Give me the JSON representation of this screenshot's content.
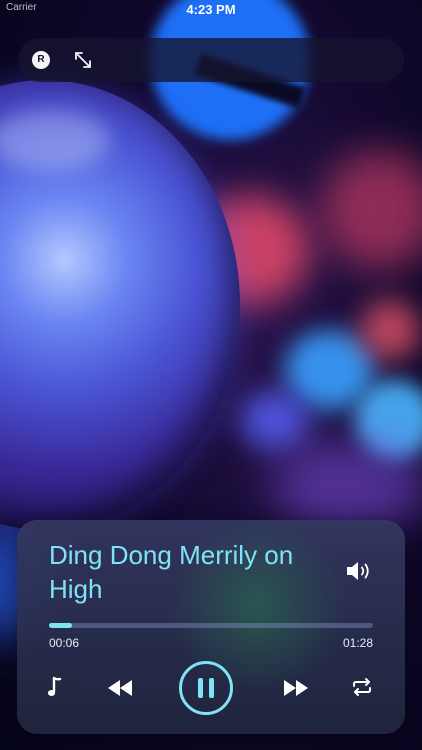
{
  "status_bar": {
    "carrier": "Carrier",
    "time": "4:23 PM"
  },
  "top_bar": {
    "badge_label": "R",
    "expand_icon": "expand-icon"
  },
  "player": {
    "title": "Ding Dong Merrily on High",
    "elapsed": "00:06",
    "total": "01:28",
    "progress": 0.07,
    "state": "playing",
    "accent_color": "#7fe3f6",
    "icons": [
      "music-note-icon",
      "rewind-icon",
      "pause-icon",
      "fast-forward-icon",
      "repeat-icon",
      "volume-icon"
    ]
  }
}
